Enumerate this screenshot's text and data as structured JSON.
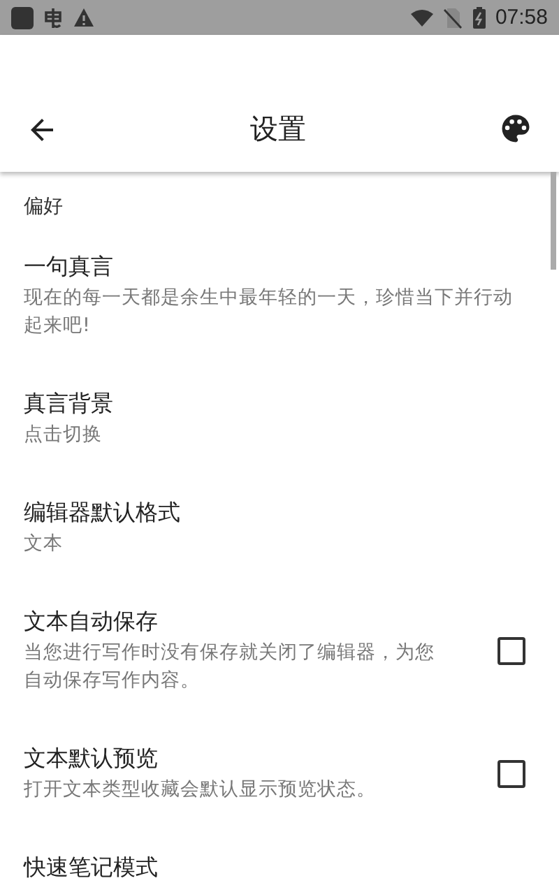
{
  "status_bar": {
    "time": "07:58"
  },
  "toolbar": {
    "title": "设置"
  },
  "section": {
    "title": "偏好"
  },
  "items": [
    {
      "kind": "text",
      "title": "一句真言",
      "summary": "现在的每一天都是余生中最年轻的一天，珍惜当下并行动起来吧!"
    },
    {
      "kind": "text",
      "title": "真言背景",
      "summary": "点击切换"
    },
    {
      "kind": "text",
      "title": "编辑器默认格式",
      "summary": "文本"
    },
    {
      "kind": "checkbox",
      "title": "文本自动保存",
      "summary": "当您进行写作时没有保存就关闭了编辑器，为您自动保存写作内容。",
      "checked": false
    },
    {
      "kind": "checkbox",
      "title": "文本默认预览",
      "summary": "打开文本类型收藏会默认显示预览状态。",
      "checked": false
    },
    {
      "kind": "text",
      "title": "快速笔记模式"
    }
  ]
}
